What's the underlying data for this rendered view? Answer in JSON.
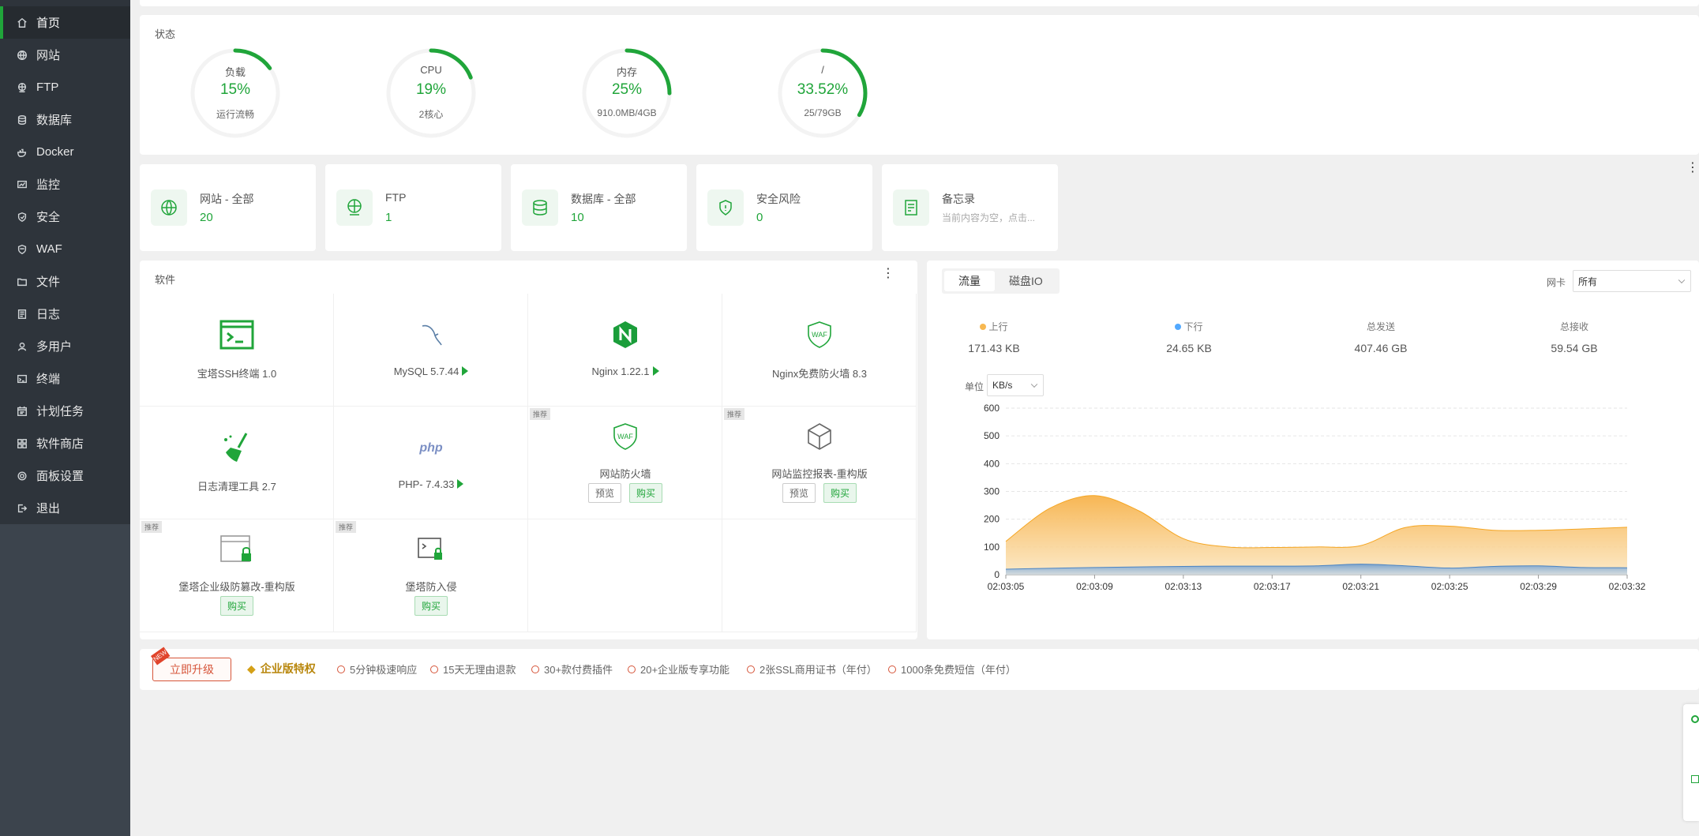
{
  "sidebar": {
    "items": [
      {
        "label": "首页",
        "icon": "home-icon",
        "active": true
      },
      {
        "label": "网站",
        "icon": "globe-icon"
      },
      {
        "label": "FTP",
        "icon": "ftp-icon"
      },
      {
        "label": "数据库",
        "icon": "database-icon"
      },
      {
        "label": "Docker",
        "icon": "docker-icon"
      },
      {
        "label": "监控",
        "icon": "monitor-icon"
      },
      {
        "label": "安全",
        "icon": "shield-icon"
      },
      {
        "label": "WAF",
        "icon": "waf-icon"
      },
      {
        "label": "文件",
        "icon": "folder-icon"
      },
      {
        "label": "日志",
        "icon": "log-icon"
      },
      {
        "label": "多用户",
        "icon": "users-icon"
      },
      {
        "label": "终端",
        "icon": "terminal-icon"
      },
      {
        "label": "计划任务",
        "icon": "calendar-icon"
      },
      {
        "label": "软件商店",
        "icon": "store-icon"
      },
      {
        "label": "面板设置",
        "icon": "gear-icon"
      },
      {
        "label": "退出",
        "icon": "logout-icon"
      }
    ]
  },
  "status": {
    "title": "状态",
    "rings": [
      {
        "label": "负载",
        "value": "15%",
        "sub": "运行流畅",
        "pct": 15
      },
      {
        "label": "CPU",
        "value": "19%",
        "sub": "2核心",
        "pct": 19
      },
      {
        "label": "内存",
        "value": "25%",
        "sub": "910.0MB/4GB",
        "pct": 25
      },
      {
        "label": "/",
        "value": "33.52%",
        "sub": "25/79GB",
        "pct": 33.52
      }
    ]
  },
  "cards": [
    {
      "title": "网站 - 全部",
      "value": "20",
      "icon": "globe-icon"
    },
    {
      "title": "FTP",
      "value": "1",
      "icon": "ftp-icon"
    },
    {
      "title": "数据库 - 全部",
      "value": "10",
      "icon": "database-icon"
    },
    {
      "title": "安全风险",
      "value": "0",
      "icon": "shield-icon"
    },
    {
      "title": "备忘录",
      "value": "当前内容为空，点击...",
      "icon": "note-icon"
    }
  ],
  "software": {
    "title": "软件",
    "preview_label": "预览",
    "buy_label": "购买",
    "recommend_label": "推荐",
    "items": [
      {
        "name": "宝塔SSH终端 1.0"
      },
      {
        "name": "MySQL 5.7.44"
      },
      {
        "name": "Nginx 1.22.1"
      },
      {
        "name": "Nginx免费防火墙 8.3"
      },
      {
        "name": "日志清理工具 2.7"
      },
      {
        "name": "PHP- 7.4.33"
      },
      {
        "name": "网站防火墙"
      },
      {
        "name": "网站监控报表-重构版"
      },
      {
        "name": "堡塔企业级防篡改-重构版"
      },
      {
        "name": "堡塔防入侵"
      }
    ]
  },
  "traffic": {
    "tabs": [
      "流量",
      "磁盘IO"
    ],
    "nic_label": "网卡",
    "nic_value": "所有",
    "unit_label": "单位",
    "unit_value": "KB/s",
    "stats": [
      {
        "label": "上行",
        "value": "171.43 KB",
        "color": "#f7b851"
      },
      {
        "label": "下行",
        "value": "24.65 KB",
        "color": "#52a9ff"
      },
      {
        "label": "总发送",
        "value": "407.46 GB"
      },
      {
        "label": "总接收",
        "value": "59.54 GB"
      }
    ]
  },
  "chart_data": {
    "type": "area",
    "x": [
      "02:03:05",
      "02:03:07",
      "02:03:09",
      "02:03:11",
      "02:03:13",
      "02:03:15",
      "02:03:17",
      "02:03:19",
      "02:03:21",
      "02:03:23",
      "02:03:25",
      "02:03:27",
      "02:03:29",
      "02:03:31",
      "02:03:32"
    ],
    "xticks": [
      "02:03:05",
      "02:03:09",
      "02:03:13",
      "02:03:17",
      "02:03:21",
      "02:03:25",
      "02:03:29",
      "02:03:32"
    ],
    "series": [
      {
        "name": "上行",
        "color": "#f7b851",
        "values": [
          120,
          240,
          285,
          230,
          130,
          100,
          98,
          100,
          105,
          170,
          175,
          160,
          160,
          165,
          171
        ]
      },
      {
        "name": "下行",
        "color": "#6fa3d8",
        "values": [
          20,
          23,
          26,
          28,
          30,
          31,
          31,
          32,
          38,
          32,
          24,
          30,
          32,
          26,
          25
        ]
      }
    ],
    "ylim": [
      0,
      600
    ],
    "yticks": [
      0,
      100,
      200,
      300,
      400,
      500,
      600
    ],
    "grid": true
  },
  "upgrade": {
    "button": "立即升级",
    "badge": "NEW",
    "enterprise": "企业版特权",
    "features": [
      "5分钟极速响应",
      "15天无理由退款",
      "30+款付费插件",
      "20+企业版专享功能",
      "2张SSL商用证书（年付）",
      "1000条免费短信（年付）"
    ]
  }
}
